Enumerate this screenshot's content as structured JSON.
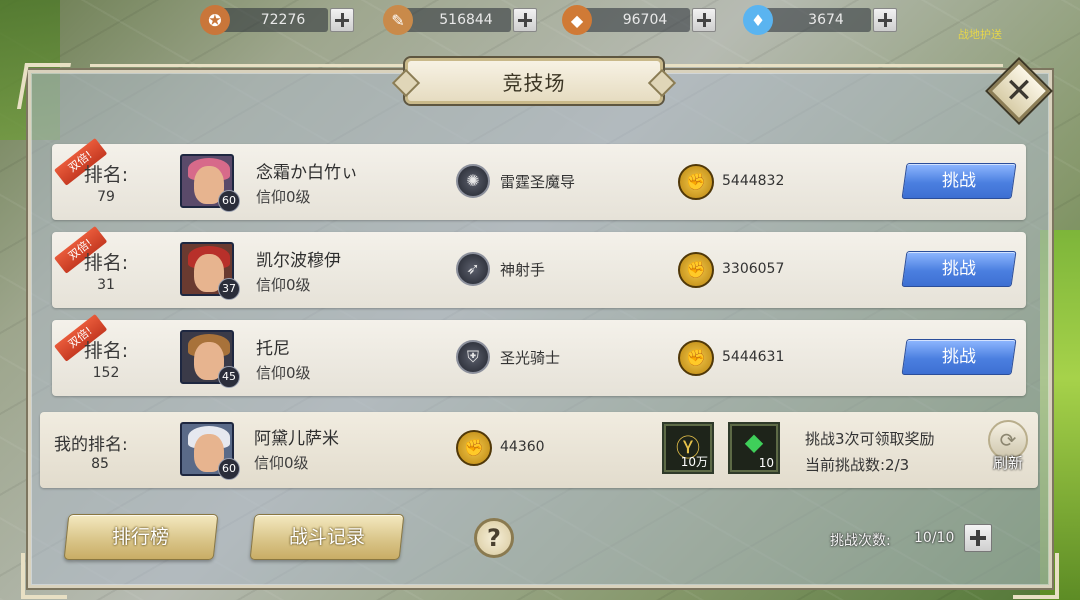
{
  "resources": [
    {
      "icon": "medal-icon",
      "value": "72276",
      "color": "#c9763a"
    },
    {
      "icon": "scroll-icon",
      "value": "516844",
      "color": "#c98a4a"
    },
    {
      "icon": "ore-icon",
      "value": "96704",
      "color": "#d07a36"
    },
    {
      "icon": "diamond-icon",
      "value": "3674",
      "color": "#5ab4f0"
    }
  ],
  "top_link": "战地护送",
  "title": "竞技场",
  "opponents": [
    {
      "badge": "双倍!",
      "rank_label": "排名:",
      "rank": "79",
      "name": "念霜か白竹ぃ",
      "faith": "信仰0级",
      "level": "60",
      "class_name": "雷霆圣魔导",
      "class_icon": "thunder-class-icon",
      "power": "5444832",
      "button": "挑战",
      "hair_color": "#d76a8a"
    },
    {
      "badge": "双倍!",
      "rank_label": "排名:",
      "rank": "31",
      "name": "凯尔波穆伊",
      "faith": "信仰0级",
      "level": "37",
      "class_name": "神射手",
      "class_icon": "archer-class-icon",
      "power": "3306057",
      "button": "挑战",
      "hair_color": "#b8302a"
    },
    {
      "badge": "双倍!",
      "rank_label": "排名:",
      "rank": "152",
      "name": "托尼",
      "faith": "信仰0级",
      "level": "45",
      "class_name": "圣光骑士",
      "class_icon": "paladin-class-icon",
      "power": "5444631",
      "button": "挑战",
      "hair_color": "#a8723a"
    }
  ],
  "me": {
    "rank_label": "我的排名:",
    "rank": "85",
    "name": "阿黛儿萨米",
    "faith": "信仰0级",
    "level": "60",
    "power": "44360",
    "hair_color": "#e6e8ef",
    "rewards": [
      {
        "icon": "gold-coin-reward-icon",
        "qty": "10万"
      },
      {
        "icon": "emerald-gem-reward-icon",
        "qty": "10"
      }
    ],
    "reward_hint": "挑战3次可领取奖励",
    "challenge_count": "当前挑战数:2/3",
    "refresh": "刷新"
  },
  "bottom": {
    "leaderboard": "排行榜",
    "battle_log": "战斗记录",
    "help": "?",
    "attempts_label": "挑战次数:",
    "attempts_value": "10/10"
  }
}
